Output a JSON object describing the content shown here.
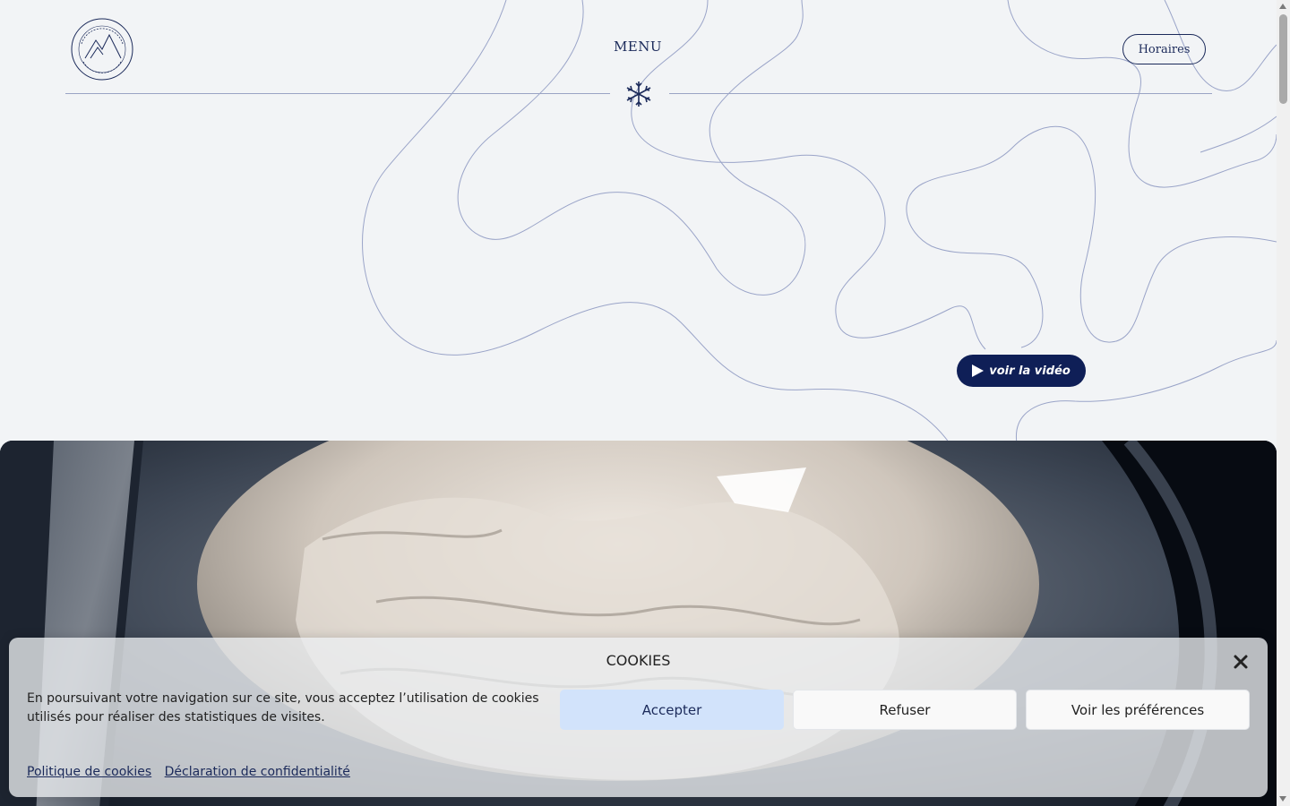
{
  "header": {
    "menu_label": "MENU",
    "horaires_label": "Horaires",
    "logo_icon": "blanc-comme-neige-logo"
  },
  "hero": {
    "video_button_label": "voir la vidéo",
    "image_alt": "laundry-drum-with-quilt-photo"
  },
  "cookies": {
    "title": "COOKIES",
    "text": "En poursuivant votre navigation sur ce site, vous acceptez l’utilisation de cookies utilisés pour réaliser des statistiques de visites.",
    "accept_label": "Accepter",
    "refuse_label": "Refuser",
    "preferences_label": "Voir les préférences",
    "cookie_policy_link": "Politique de cookies",
    "privacy_link": "Déclaration de confidentialité"
  },
  "colors": {
    "navy": "#1b2a5a",
    "video_button": "#0f1f57",
    "accept_button": "#d2e3fb",
    "background": "#f2f4f6"
  }
}
